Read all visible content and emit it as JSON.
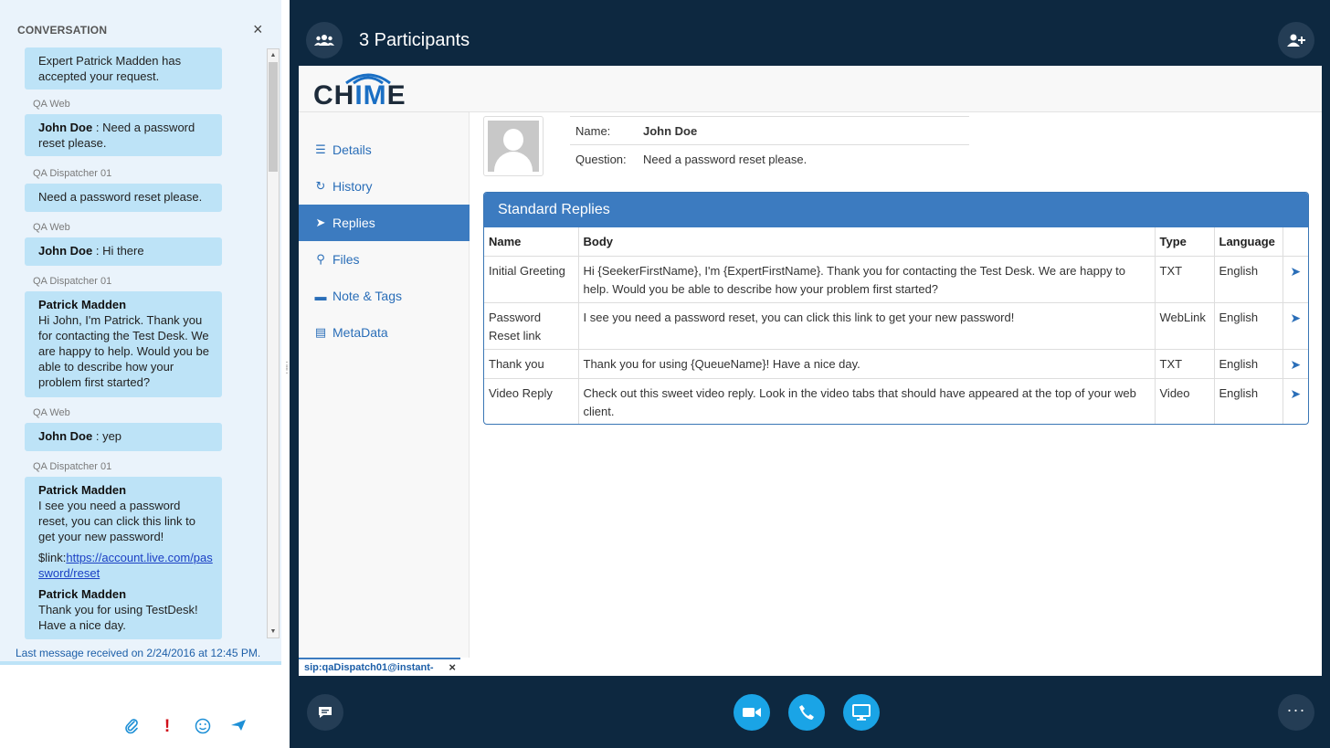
{
  "conversation": {
    "header": "CONVERSATION",
    "close_glyph": "×",
    "messages": [
      {
        "sender": "",
        "author": "",
        "text": "Expert Patrick Madden has accepted your request."
      },
      {
        "sender": "QA Web",
        "author": "John Doe",
        "text": " : Need a password reset please."
      },
      {
        "sender": "QA Dispatcher 01",
        "author": "",
        "text": "Need a password reset please."
      },
      {
        "sender": "QA Web",
        "author": "John Doe",
        "text": " : Hi there"
      },
      {
        "sender": "QA Dispatcher 01",
        "author": "Patrick Madden",
        "text": "Hi John, I'm Patrick. Thank you for contacting the Test Desk. We are happy to help. Would you be able to describe how your problem first started?"
      },
      {
        "sender": "QA Web",
        "author": "John Doe",
        "text": " : yep"
      },
      {
        "sender": "QA Dispatcher 01",
        "author": "Patrick Madden",
        "text": "I see you need a password reset, you can click this link to get your new password!",
        "link_prefix": "$link:",
        "link": "https://account.live.com/password/reset",
        "author2": "Patrick Madden",
        "text2": "Thank you for using TestDesk! Have a nice day."
      }
    ],
    "last_message": "Last message received on 2/24/2016 at 12:45 PM.",
    "compose_icons": [
      "paperclip-icon",
      "important-icon",
      "emoji-icon",
      "send-icon"
    ]
  },
  "call": {
    "participants_title": "3 Participants",
    "sip_tab": "sip:qaDispatch01@instant-",
    "sip_close": "×"
  },
  "app": {
    "logo_text_left": "CH",
    "logo_text_mid": "IM",
    "logo_text_right": "E",
    "nav": [
      {
        "label": "Details",
        "icon": "list-icon",
        "glyph": "☰",
        "active": false
      },
      {
        "label": "History",
        "icon": "history-icon",
        "glyph": "↻",
        "active": false
      },
      {
        "label": "Replies",
        "icon": "send-icon",
        "glyph": "➤",
        "active": true
      },
      {
        "label": "Files",
        "icon": "paperclip-icon",
        "glyph": "⚲",
        "active": false
      },
      {
        "label": "Note & Tags",
        "icon": "comment-icon",
        "glyph": "▬",
        "active": false
      },
      {
        "label": "MetaData",
        "icon": "table-icon",
        "glyph": "▤",
        "active": false
      }
    ],
    "profile": {
      "name_label": "Name:",
      "name_value": "John Doe",
      "question_label": "Question:",
      "question_value": "Need a password reset please."
    },
    "replies": {
      "title": "Standard Replies",
      "columns": [
        "Name",
        "Body",
        "Type",
        "Language",
        ""
      ],
      "rows": [
        {
          "name": "Initial Greeting",
          "body": "Hi {SeekerFirstName}, I'm {ExpertFirstName}. Thank you for contacting the Test Desk. We are happy to help. Would you be able to describe how your problem first started?",
          "type": "TXT",
          "language": "English"
        },
        {
          "name": "Password Reset link",
          "body": "I see you need a password reset, you can click this link to get your new password!",
          "type": "WebLink",
          "language": "English"
        },
        {
          "name": "Thank you",
          "body": "Thank you for using {QueueName}! Have a nice day.",
          "type": "TXT",
          "language": "English"
        },
        {
          "name": "Video Reply",
          "body": "Check out this sweet video reply. Look in the video tabs that should have appeared at the top of your web client.",
          "type": "Video",
          "language": "English"
        }
      ]
    }
  },
  "colors": {
    "dark_bg": "#0d2840",
    "accent": "#3c7bc0",
    "call_blue": "#1aa4e6",
    "bubble": "#bde3f7"
  }
}
